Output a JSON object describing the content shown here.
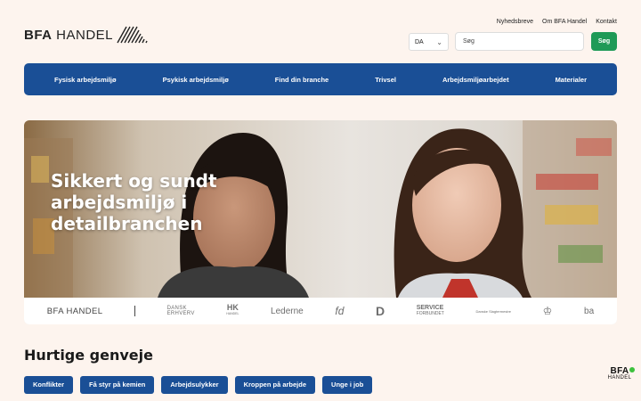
{
  "header": {
    "logo_bold": "BFA",
    "logo_rest": " HANDEL",
    "top_links": [
      "Nyhedsbreve",
      "Om BFA Handel",
      "Kontakt"
    ],
    "language": "DA",
    "search_placeholder": "Søg",
    "search_button": "Søg"
  },
  "nav": {
    "items": [
      "Fysisk arbejdsmiljø",
      "Psykisk arbejdsmiljø",
      "Find din branche",
      "Trivsel",
      "Arbejdsmiljøarbejdet",
      "Materialer"
    ]
  },
  "hero": {
    "title": "Sikkert og sundt arbejdsmiljø i detailbranchen"
  },
  "partners": {
    "bfa": "BFA HANDEL",
    "dansk_1": "DANSK",
    "dansk_2": "ERHVERV",
    "hk": "HK",
    "hk_small": "HANDEL",
    "lederne": "Lederne",
    "fd": "fd",
    "d": "D",
    "service_1": "SERVICE",
    "service_2": "FORBUNDET",
    "slagter": "Danske Slagtermestre",
    "ba": "ba"
  },
  "quick_links": {
    "heading": "Hurtige genveje",
    "items": [
      "Konflikter",
      "Få styr på kemien",
      "Arbejdsulykker",
      "Kroppen på arbejde",
      "Unge i job"
    ]
  },
  "corner_logo": {
    "big": "BFA",
    "small": "HANDEL"
  },
  "colors": {
    "primary_blue": "#1a4f96",
    "green": "#1f9a57",
    "background": "#fdf4ee"
  }
}
